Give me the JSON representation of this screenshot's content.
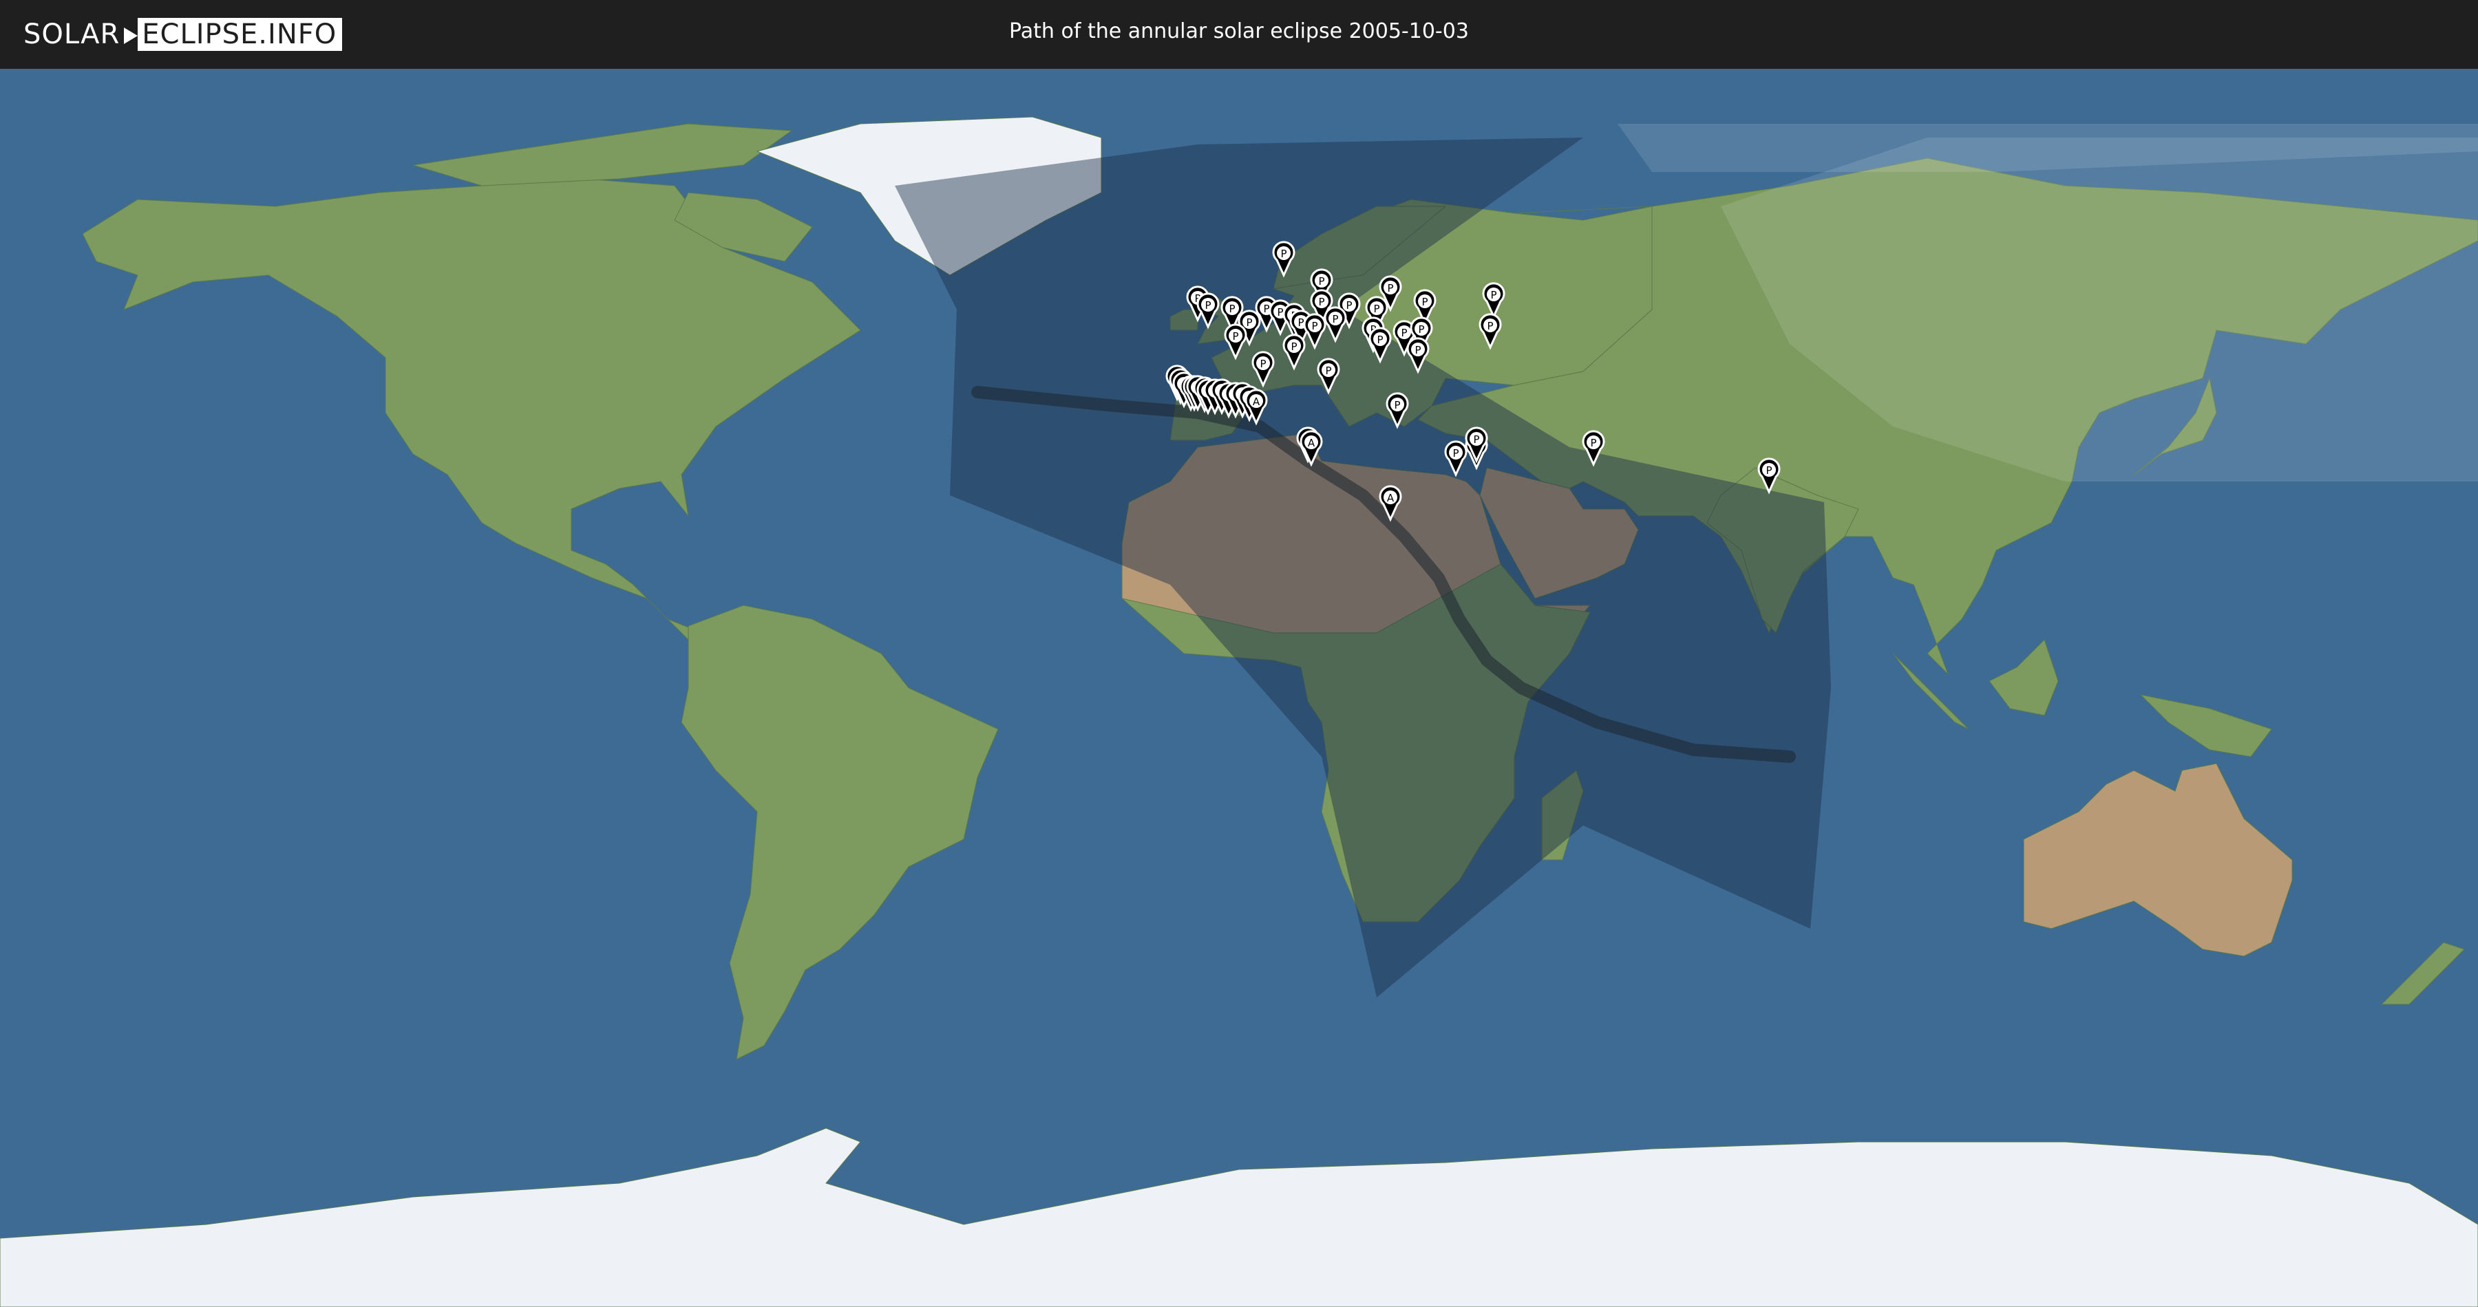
{
  "header": {
    "logo_left": "SOLAR",
    "logo_right": "ECLIPSE.INFO",
    "title": "Path of the annular solar eclipse 2005-10-03"
  },
  "map": {
    "projection": "equirectangular",
    "colors": {
      "ocean": "#3d6b94",
      "land": "#7d9a5f",
      "desert": "#b89a76",
      "ice": "#eef2f6",
      "shadow_zone": "#1a2f4a",
      "central_path": "#1c2430",
      "night_overlay": "#ffffff",
      "marker_fill": "#000000",
      "marker_label": "#ffffff"
    },
    "partial_zone_outline_lonlat": [
      [
        -50,
        73
      ],
      [
        -6,
        79
      ],
      [
        50,
        80
      ],
      [
        15,
        55
      ],
      [
        48,
        35
      ],
      [
        85,
        27
      ],
      [
        86,
        0
      ],
      [
        83,
        -35
      ],
      [
        50,
        -20
      ],
      [
        20,
        -45
      ],
      [
        12,
        -10
      ],
      [
        -10,
        15
      ],
      [
        -42,
        28
      ],
      [
        -41,
        55
      ]
    ],
    "annular_path_lonlat": [
      [
        -38,
        43
      ],
      [
        -18,
        41
      ],
      [
        -6,
        40
      ],
      [
        3,
        38
      ],
      [
        10,
        33
      ],
      [
        18,
        28
      ],
      [
        24,
        22
      ],
      [
        29,
        16
      ],
      [
        32,
        10
      ],
      [
        36,
        4
      ],
      [
        41,
        0
      ],
      [
        52,
        -5
      ],
      [
        66,
        -9
      ],
      [
        80,
        -10
      ]
    ],
    "markers": [
      {
        "type": "P",
        "lon": 6.5,
        "lat": 60
      },
      {
        "type": "P",
        "lon": 12,
        "lat": 56
      },
      {
        "type": "P",
        "lon": 22,
        "lat": 55
      },
      {
        "type": "P",
        "lon": 27,
        "lat": 53
      },
      {
        "type": "P",
        "lon": 12,
        "lat": 53
      },
      {
        "type": "P",
        "lon": 16,
        "lat": 52.5
      },
      {
        "type": "P",
        "lon": 20,
        "lat": 52
      },
      {
        "type": "P",
        "lon": 4,
        "lat": 52
      },
      {
        "type": "P",
        "lon": 6,
        "lat": 51.5
      },
      {
        "type": "P",
        "lon": -6,
        "lat": 53.5
      },
      {
        "type": "P",
        "lon": -4.5,
        "lat": 52.5
      },
      {
        "type": "P",
        "lon": -1,
        "lat": 52
      },
      {
        "type": "P",
        "lon": 8,
        "lat": 51
      },
      {
        "type": "P",
        "lon": 14,
        "lat": 50.5
      },
      {
        "type": "P",
        "lon": 9,
        "lat": 50
      },
      {
        "type": "P",
        "lon": 1.5,
        "lat": 50
      },
      {
        "type": "P",
        "lon": 11,
        "lat": 49.5
      },
      {
        "type": "P",
        "lon": 19.5,
        "lat": 49
      },
      {
        "type": "P",
        "lon": 24,
        "lat": 48.5
      },
      {
        "type": "P",
        "lon": 26.5,
        "lat": 49
      },
      {
        "type": "P",
        "lon": 37,
        "lat": 54
      },
      {
        "type": "P",
        "lon": 36.5,
        "lat": 49.5
      },
      {
        "type": "P",
        "lon": 20.5,
        "lat": 47.5
      },
      {
        "type": "P",
        "lon": 26,
        "lat": 46
      },
      {
        "type": "P",
        "lon": -0.5,
        "lat": 48
      },
      {
        "type": "P",
        "lon": 8,
        "lat": 46.5
      },
      {
        "type": "P",
        "lon": 3.5,
        "lat": 44
      },
      {
        "type": "P",
        "lon": 13,
        "lat": 43
      },
      {
        "type": "P",
        "lon": 23,
        "lat": 38
      },
      {
        "type": "P",
        "lon": 31.5,
        "lat": 31
      },
      {
        "type": "P",
        "lon": 34.5,
        "lat": 32
      },
      {
        "type": "P",
        "lon": 34.5,
        "lat": 33
      },
      {
        "type": "P",
        "lon": 51.5,
        "lat": 32.5
      },
      {
        "type": "P",
        "lon": 77,
        "lat": 28.5
      },
      {
        "type": "P",
        "lon": -9,
        "lat": 42
      },
      {
        "type": "P",
        "lon": -8.5,
        "lat": 41.5
      },
      {
        "type": "A",
        "lon": -8,
        "lat": 41
      },
      {
        "type": "A",
        "lon": -7,
        "lat": 40.5
      },
      {
        "type": "A",
        "lon": -6.5,
        "lat": 40.5
      },
      {
        "type": "A",
        "lon": -6,
        "lat": 40.5
      },
      {
        "type": "A",
        "lon": -5,
        "lat": 40.3
      },
      {
        "type": "A",
        "lon": -4.5,
        "lat": 40
      },
      {
        "type": "A",
        "lon": -3.5,
        "lat": 40
      },
      {
        "type": "A",
        "lon": -2.5,
        "lat": 40
      },
      {
        "type": "A",
        "lon": -1.5,
        "lat": 39.5
      },
      {
        "type": "A",
        "lon": -0.5,
        "lat": 39.5
      },
      {
        "type": "A",
        "lon": 0.5,
        "lat": 39.5
      },
      {
        "type": "A",
        "lon": 1.5,
        "lat": 39
      },
      {
        "type": "A",
        "lon": 2.5,
        "lat": 38.5
      },
      {
        "type": "A",
        "lon": 10,
        "lat": 33
      },
      {
        "type": "A",
        "lon": 10.5,
        "lat": 32.5
      },
      {
        "type": "A",
        "lon": 22,
        "lat": 24.5
      }
    ]
  }
}
